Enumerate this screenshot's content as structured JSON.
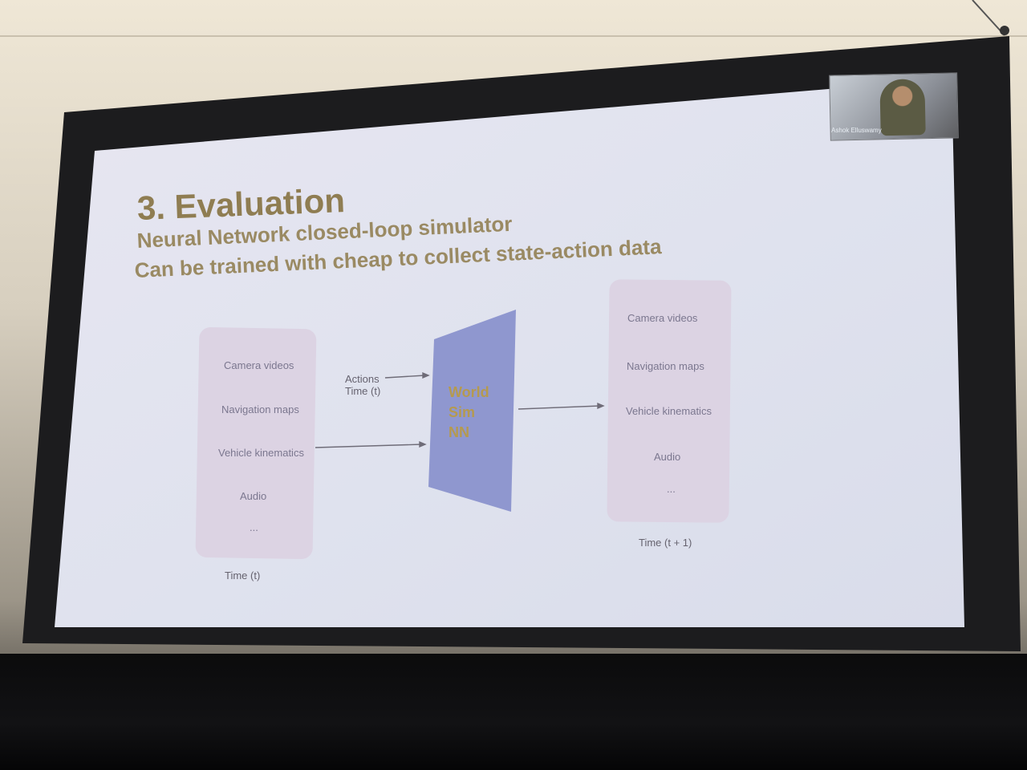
{
  "slide": {
    "title": "3. Evaluation",
    "subtitle_line1": "Neural Network closed-loop simulator",
    "subtitle_line2": "Can be trained with cheap to collect state-action data"
  },
  "diagram": {
    "input_box": {
      "items": [
        "Camera videos",
        "Navigation maps",
        "Vehicle kinematics",
        "Audio",
        "..."
      ],
      "caption": "Time (t)"
    },
    "actions_label_line1": "Actions",
    "actions_label_line2": "Time (t)",
    "model_label": [
      "World",
      "Sim",
      "NN"
    ],
    "output_box": {
      "items": [
        "Camera videos",
        "Navigation maps",
        "Vehicle kinematics",
        "Audio",
        "..."
      ],
      "caption": "Time (t + 1)"
    }
  },
  "video_call": {
    "participant_name": "Ashok Elluswamy"
  },
  "colors": {
    "title": "#8f7d52",
    "model_fill": "#8f97cf",
    "box_fill": "#dcd3e3",
    "slide_bg": "#dee1ee"
  }
}
